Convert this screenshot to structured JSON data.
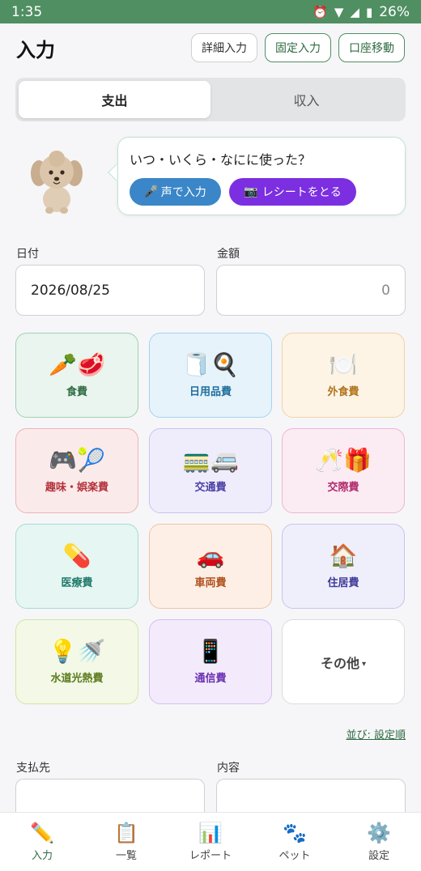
{
  "status": {
    "time": "1:35",
    "battery": "26%"
  },
  "header": {
    "title": "入力",
    "buttons": [
      {
        "label": "詳細入力"
      },
      {
        "label": "固定入力"
      },
      {
        "label": "口座移動"
      }
    ]
  },
  "segment": {
    "expense": "支出",
    "income": "収入",
    "selected": "支出"
  },
  "assistant": {
    "question": "いつ・いくら・なにに使った？",
    "voice_icon": "🎤",
    "voice_label": "声で入力",
    "receipt_icon": "📷",
    "receipt_label": "レシートをとる"
  },
  "form": {
    "date_label": "日付",
    "date_value": "2026/08/25",
    "amount_label": "金額",
    "amount_value": "0",
    "payee_label": "支払先",
    "content_label": "内容"
  },
  "categories": [
    {
      "label": "食費",
      "icons": "🥕🥩",
      "bg": "#e9f5ee",
      "border": "#9fd1b3",
      "color": "#2e6b41"
    },
    {
      "label": "日用品費",
      "icons": "🧻🍳",
      "bg": "#e6f3fb",
      "border": "#a6d3ef",
      "color": "#1f6e9c"
    },
    {
      "label": "外食費",
      "icons": "🍽️",
      "bg": "#fdf4e6",
      "border": "#f0d2a3",
      "color": "#b0741c"
    },
    {
      "label": "趣味・娯楽費",
      "icons": "🎮🎾",
      "bg": "#fbeaea",
      "border": "#f0b3b3",
      "color": "#b3313b"
    },
    {
      "label": "交通費",
      "icons": "🚃🚐",
      "bg": "#efedfb",
      "border": "#c9c3ef",
      "color": "#4b3fa6"
    },
    {
      "label": "交際費",
      "icons": "🥂🎁",
      "bg": "#fbebf3",
      "border": "#efb6d2",
      "color": "#b02a6b"
    },
    {
      "label": "医療費",
      "icons": "💊",
      "bg": "#e6f6f3",
      "border": "#a6dcd1",
      "color": "#1f7a6b"
    },
    {
      "label": "車両費",
      "icons": "🚗",
      "bg": "#fdefe6",
      "border": "#f1c3a3",
      "color": "#b04f1c"
    },
    {
      "label": "住居費",
      "icons": "🏠",
      "bg": "#efeefb",
      "border": "#c7c4ee",
      "color": "#3f3a99"
    },
    {
      "label": "水道光熱費",
      "icons": "💡🚿",
      "bg": "#f3f9e6",
      "border": "#cfe6a3",
      "color": "#5b7a1c"
    },
    {
      "label": "通信費",
      "icons": "📱",
      "bg": "#f3ebfb",
      "border": "#d6bdf0",
      "color": "#6a2fb0"
    }
  ],
  "other_category": {
    "label": "その他",
    "caret": "▾"
  },
  "sort_link": "並び: 設定順",
  "bottom_nav": [
    {
      "label": "入力",
      "icon": "✏️",
      "name": "input"
    },
    {
      "label": "一覧",
      "icon": "📋",
      "name": "list"
    },
    {
      "label": "レポート",
      "icon": "📊",
      "name": "report"
    },
    {
      "label": "ペット",
      "icon": "🐾",
      "name": "pet"
    },
    {
      "label": "設定",
      "icon": "⚙️",
      "name": "settings"
    }
  ]
}
